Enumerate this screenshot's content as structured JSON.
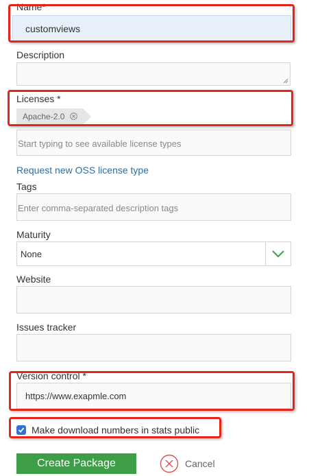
{
  "form": {
    "name": {
      "label": "Name*",
      "value": "customviews"
    },
    "description": {
      "label": "Description",
      "value": ""
    },
    "licenses": {
      "label": "Licenses *",
      "selected": [
        "Apache-2.0"
      ],
      "search_placeholder": "Start typing to see available license types",
      "request_link": "Request new OSS license type"
    },
    "tags": {
      "label": "Tags",
      "placeholder": "Enter comma-separated description tags"
    },
    "maturity": {
      "label": "Maturity",
      "value": "None"
    },
    "website": {
      "label": "Website",
      "value": ""
    },
    "issues_tracker": {
      "label": "Issues tracker",
      "value": ""
    },
    "version_control": {
      "label": "Version control *",
      "value": "https://www.exapmle.com"
    },
    "public_stats": {
      "label": "Make download numbers in stats public",
      "checked": true
    },
    "actions": {
      "create": "Create Package",
      "cancel": "Cancel"
    }
  },
  "colors": {
    "highlight": "#e3261a",
    "primary_button": "#3d9e47",
    "link": "#2b6ea6",
    "focused_field": "#e8f0fb",
    "checkbox": "#2f73d6"
  },
  "icons": [
    "chip-close-icon",
    "chevron-down-icon",
    "checkmark-icon",
    "cancel-circle-x-icon",
    "resize-handle-icon"
  ]
}
